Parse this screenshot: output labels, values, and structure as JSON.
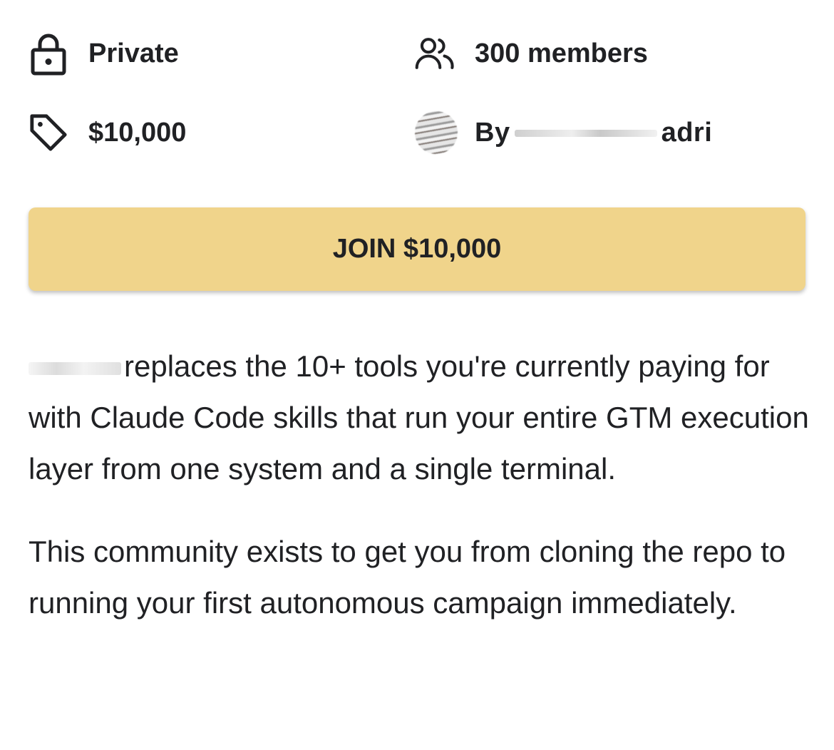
{
  "info": {
    "visibility": "Private",
    "members": "300 members",
    "price": "$10,000",
    "owner_prefix": "By",
    "owner_suffix": "adri"
  },
  "join_button": {
    "label": "JOIN $10,000",
    "color": "#f0d48b"
  },
  "description": {
    "paragraph1": "replaces the 10+ tools you're currently paying for with Claude Code skills that run your entire GTM execution layer from one system and a single terminal.",
    "paragraph2": "This community exists to get you from cloning the repo to running your first autonomous campaign immediately."
  },
  "icons": {
    "visibility": "lock-icon",
    "members": "users-icon",
    "price": "tag-icon",
    "owner": "avatar"
  }
}
